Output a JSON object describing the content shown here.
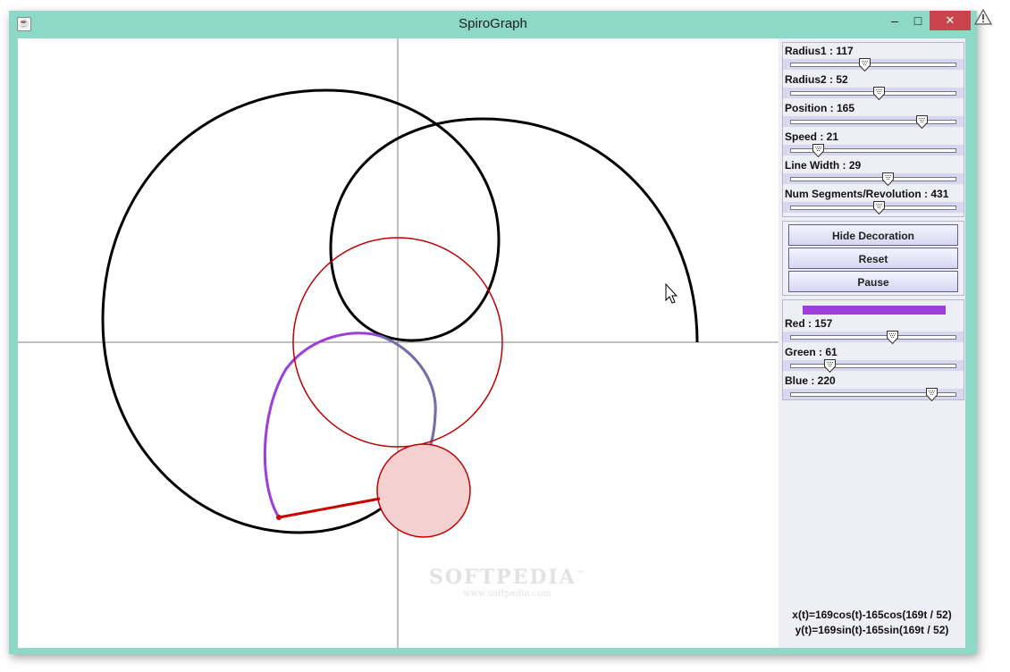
{
  "window": {
    "title": "SpiroGraph",
    "app_icon": "java-cup-icon"
  },
  "titlebar_buttons": {
    "minimize": "–",
    "maximize": "□",
    "close": "✕"
  },
  "sliders": [
    {
      "label": "Radius1 : 117",
      "fraction": 0.45
    },
    {
      "label": "Radius2 : 52",
      "fraction": 0.54
    },
    {
      "label": "Position : 165",
      "fraction": 0.8
    },
    {
      "label": "Speed : 21",
      "fraction": 0.17
    },
    {
      "label": "Line Width : 29",
      "fraction": 0.59
    },
    {
      "label": "Num Segments/Revolution : 431",
      "fraction": 0.54
    }
  ],
  "buttons": {
    "hide_decoration": "Hide Decoration",
    "reset": "Reset",
    "pause": "Pause"
  },
  "color": {
    "swatch": "#9d3ddc",
    "sliders": [
      {
        "label": "Red : 157",
        "fraction": 0.62
      },
      {
        "label": "Green : 61",
        "fraction": 0.24
      },
      {
        "label": "Blue : 220",
        "fraction": 0.86
      }
    ]
  },
  "equations": {
    "x": "x(t)=169cos(t)-165cos(169t / 52)",
    "y": "y(t)=169sin(t)-165sin(169t / 52)"
  },
  "watermark": {
    "brand": "SOFTPEDIA",
    "trademark": "™",
    "url": "www.softpedia.com"
  },
  "colors": {
    "titlebar": "#8dd8c6",
    "close_button": "#c9444c",
    "guide_circles": "#c00000",
    "rolling_disk_fill": "#f4d0d0",
    "curve": "#000000"
  }
}
